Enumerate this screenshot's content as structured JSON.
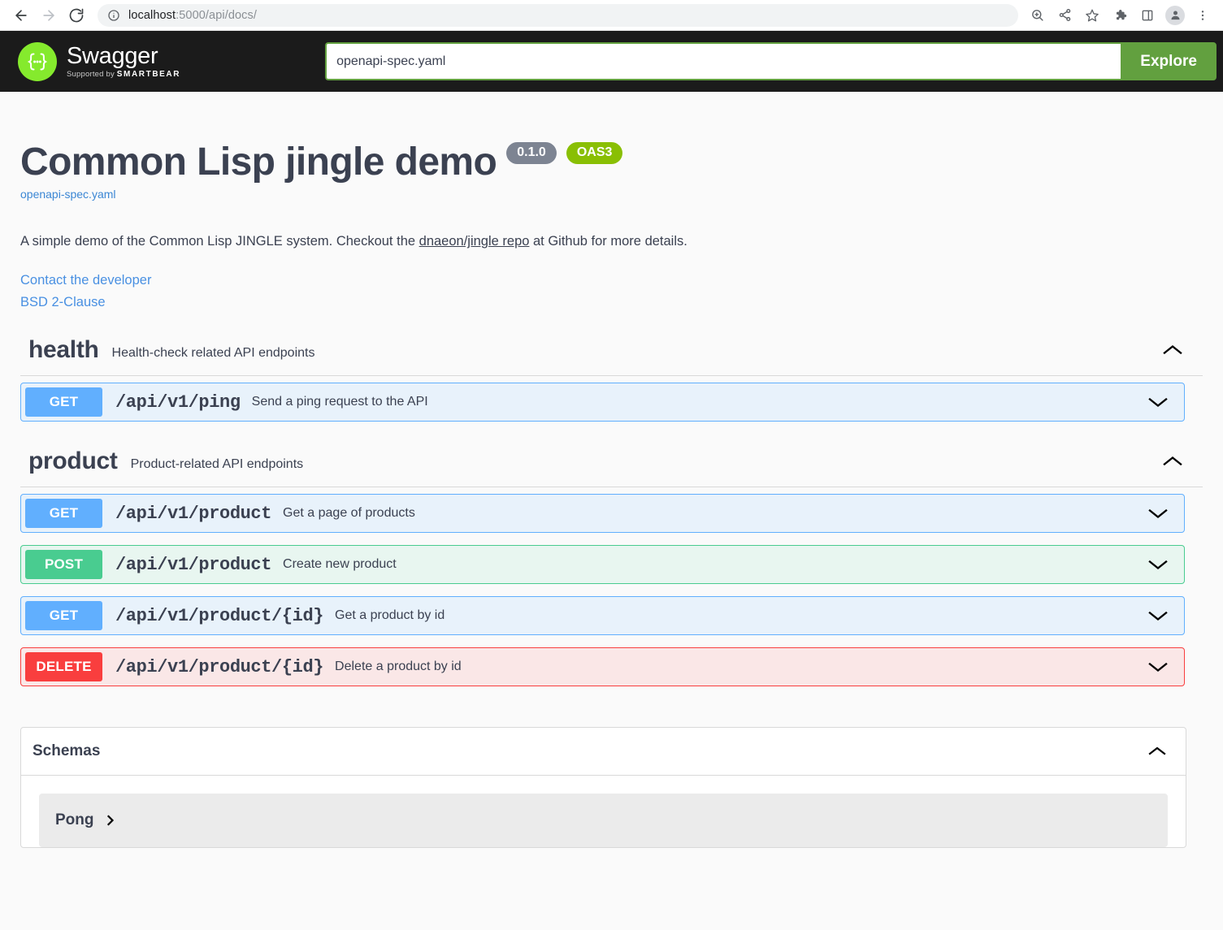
{
  "browser": {
    "url_host": "localhost",
    "url_rest": ":5000/api/docs/",
    "nav": {
      "back_label": "Back",
      "forward_label": "Forward",
      "reload_label": "Reload"
    },
    "icons": {
      "info": "info-icon",
      "zoom": "zoom-icon",
      "share": "share-icon",
      "bookmark": "star-icon",
      "extensions": "puzzle-icon",
      "split": "split-screen-icon",
      "profile": "profile-avatar-icon",
      "menu": "three-dot-menu-icon"
    }
  },
  "topbar": {
    "logo_title": "Swagger",
    "logo_sub_prefix": "Supported by ",
    "logo_sub_brand": "SMARTBEAR",
    "spec_value": "openapi-spec.yaml",
    "spec_placeholder": "openapi-spec.yaml",
    "explore_label": "Explore"
  },
  "info": {
    "title": "Common Lisp jingle demo",
    "version_badge": "0.1.0",
    "oas_badge": "OAS3",
    "spec_link": "openapi-spec.yaml",
    "description_before": "A simple demo of the Common Lisp JINGLE system. Checkout the ",
    "description_link": "dnaeon/jingle repo",
    "description_after": " at Github for more details.",
    "contact_link": "Contact the developer",
    "license_link": "BSD 2-Clause"
  },
  "tags": [
    {
      "name": "health",
      "description": "Health-check related API endpoints",
      "expanded": true,
      "operations": [
        {
          "method": "GET",
          "method_class": "get",
          "path": "/api/v1/ping",
          "summary": "Send a ping request to the API"
        }
      ]
    },
    {
      "name": "product",
      "description": "Product-related API endpoints",
      "expanded": true,
      "operations": [
        {
          "method": "GET",
          "method_class": "get",
          "path": "/api/v1/product",
          "summary": "Get a page of products"
        },
        {
          "method": "POST",
          "method_class": "post",
          "path": "/api/v1/product",
          "summary": "Create new product"
        },
        {
          "method": "GET",
          "method_class": "get",
          "path": "/api/v1/product/{id}",
          "summary": "Get a product by id"
        },
        {
          "method": "DELETE",
          "method_class": "delete",
          "path": "/api/v1/product/{id}",
          "summary": "Delete a product by id"
        }
      ]
    }
  ],
  "models": {
    "title": "Schemas",
    "expanded": true,
    "items": [
      {
        "name": "Pong"
      }
    ]
  },
  "colors": {
    "get": "#61affe",
    "post": "#49cc90",
    "delete": "#f93e3e",
    "brand_green": "#85ea2d",
    "explore_green": "#62a03f",
    "topbar_dark": "#1b1b1b",
    "text": "#3b4151",
    "link": "#4990e2",
    "version_badge": "#7d8492",
    "oas_badge": "#89bf04"
  }
}
